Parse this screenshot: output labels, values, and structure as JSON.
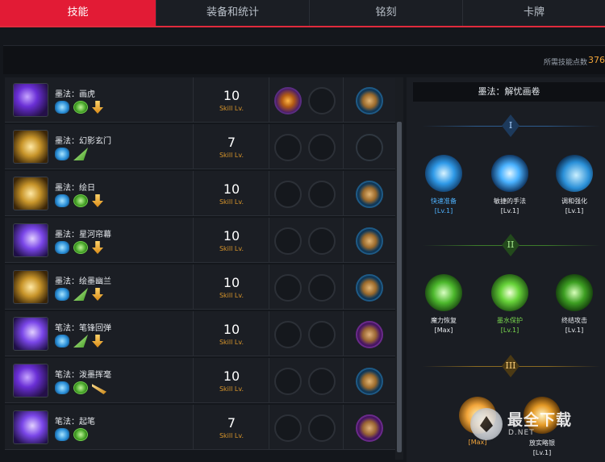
{
  "tabs": [
    {
      "label": "技能",
      "active": true
    },
    {
      "label": "装备和统计",
      "active": false
    },
    {
      "label": "铭刻",
      "active": false
    },
    {
      "label": "卡牌",
      "active": false
    }
  ],
  "points": {
    "label": "所需技能点数",
    "value": "376"
  },
  "skills": [
    {
      "name": "墨法：画虎",
      "level": "10",
      "level_label": "Skill Lv.",
      "icon": "purple-tiger-skill-icon",
      "sub_icons": [
        "blue",
        "green",
        "arrow"
      ],
      "slot1_filled": true,
      "card": "blue"
    },
    {
      "name": "墨法：幻影玄门",
      "level": "7",
      "level_label": "Skill Lv.",
      "icon": "gold-gate-skill-icon",
      "sub_icons": [
        "blue",
        "green-leaf"
      ],
      "slot1_filled": false,
      "card": "none"
    },
    {
      "name": "墨法：绘日",
      "level": "10",
      "level_label": "Skill Lv.",
      "icon": "gold-sun-skill-icon",
      "sub_icons": [
        "blue",
        "green",
        "arrow"
      ],
      "slot1_filled": false,
      "card": "blue"
    },
    {
      "name": "墨法：星河帘幕",
      "level": "10",
      "level_label": "Skill Lv.",
      "icon": "violet-galaxy-skill-icon",
      "sub_icons": [
        "blue",
        "green",
        "arrow"
      ],
      "slot1_filled": false,
      "card": "blue"
    },
    {
      "name": "墨法：绘墨幽兰",
      "level": "10",
      "level_label": "Skill Lv.",
      "icon": "gold-orchid-skill-icon",
      "sub_icons": [
        "blue",
        "green-leaf",
        "arrow"
      ],
      "slot1_filled": false,
      "card": "blue"
    },
    {
      "name": "笔法：笔锋回弹",
      "level": "10",
      "level_label": "Skill Lv.",
      "icon": "purple-rebound-skill-icon",
      "sub_icons": [
        "blue",
        "green-leaf",
        "arrow"
      ],
      "slot1_filled": false,
      "card": "purple"
    },
    {
      "name": "笔法：泼墨挥毫",
      "level": "10",
      "level_label": "Skill Lv.",
      "icon": "purple-splash-skill-icon",
      "sub_icons": [
        "blue",
        "green",
        "gold-slash"
      ],
      "slot1_filled": false,
      "card": "blue"
    },
    {
      "name": "笔法：起笔",
      "level": "7",
      "level_label": "Skill Lv.",
      "icon": "violet-brush-skill-icon",
      "sub_icons": [
        "blue",
        "green"
      ],
      "slot1_filled": false,
      "card": "purple"
    }
  ],
  "detail": {
    "title": "墨法：解忧画卷",
    "tiers": [
      "I",
      "II",
      "III"
    ],
    "nodes": [
      {
        "name": "快速准备",
        "level": "[Lv.1]",
        "color": "#4fb3ff",
        "icon": "quick-prep-icon"
      },
      {
        "name": "敏捷的手法",
        "level": "[Lv.1]",
        "color": "#e8ebef",
        "icon": "agile-hand-icon"
      },
      {
        "name": "调和强化",
        "level": "[Lv.1]",
        "color": "#e8ebef",
        "icon": "harmony-boost-icon"
      },
      {
        "name": "魔力恢复",
        "level": "[Max]",
        "color": "#e8ebef",
        "icon": "mana-recovery-icon"
      },
      {
        "name": "墨水保护",
        "level": "[Lv.1]",
        "color": "#7ad94f",
        "icon": "ink-shield-icon"
      },
      {
        "name": "终结攻击",
        "level": "[Lv.1]",
        "color": "#e8ebef",
        "icon": "finisher-attack-icon"
      },
      {
        "name": "",
        "level": "[Max]",
        "color": "#f2a53a",
        "icon": "tier3-left-icon"
      },
      {
        "name": "放实略银",
        "level": "[Lv.1]",
        "color": "#e8ebef",
        "icon": "tier3-mid-icon"
      }
    ]
  },
  "watermark": {
    "text": "最全下载",
    "sub": "D.NET"
  }
}
